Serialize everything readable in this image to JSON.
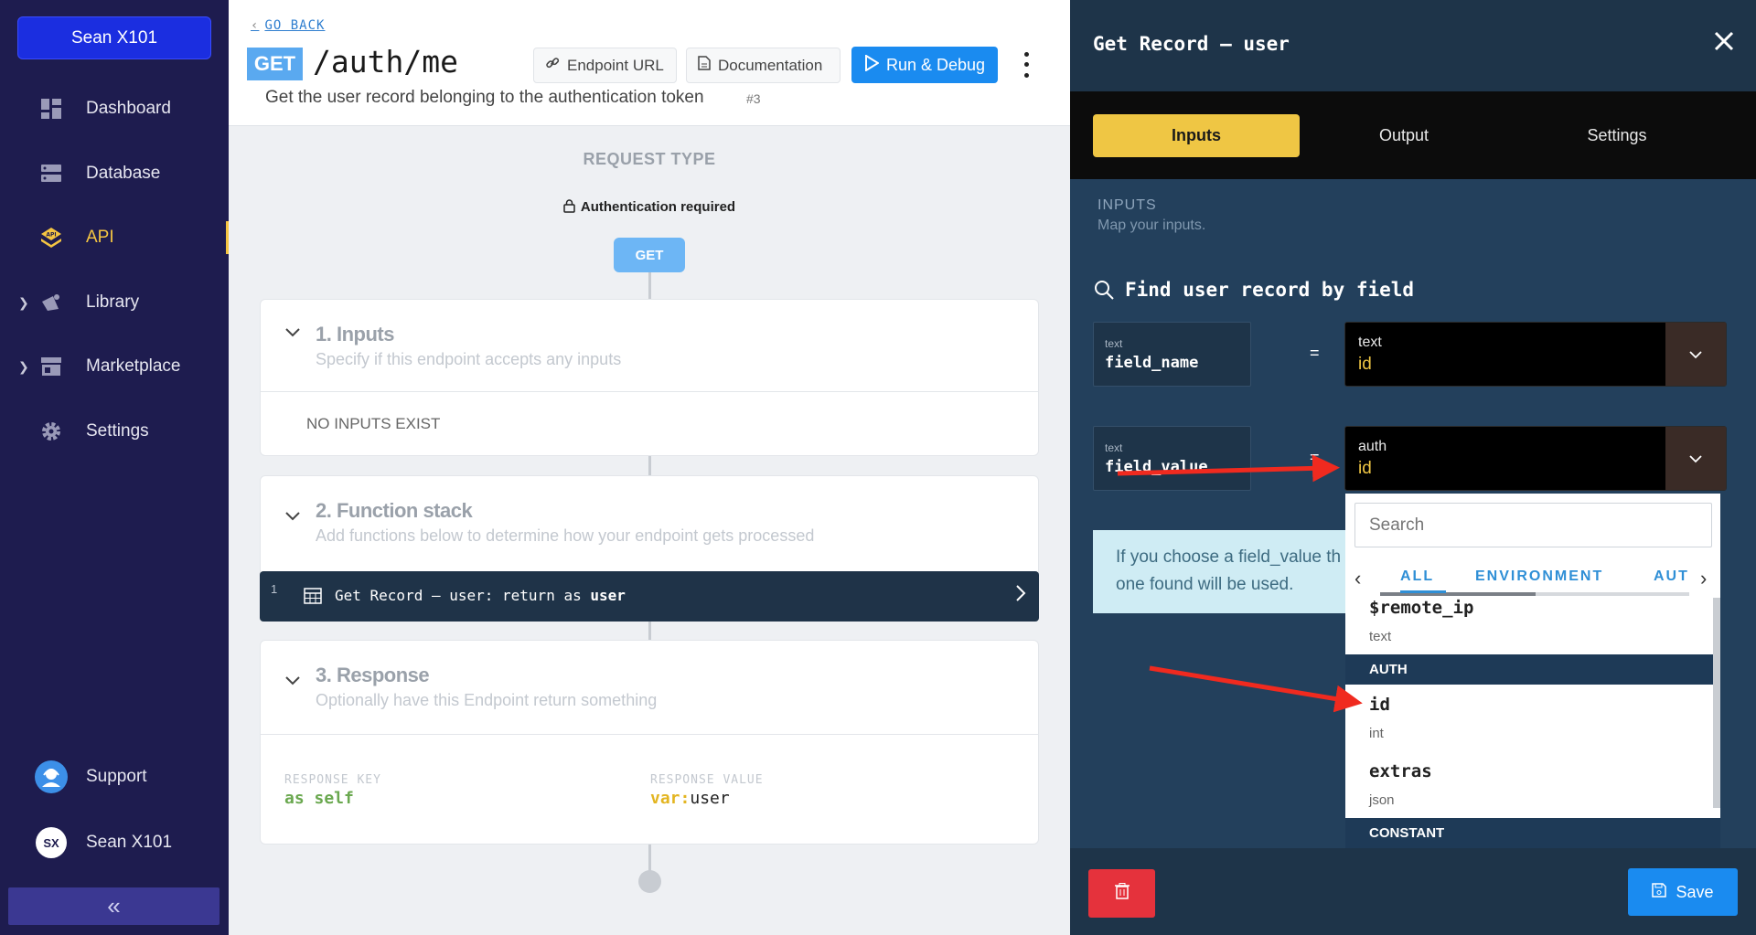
{
  "sidebar": {
    "workspace": "Sean X101",
    "items": [
      {
        "label": "Dashboard",
        "icon": "dashboard-icon"
      },
      {
        "label": "Database",
        "icon": "database-icon"
      },
      {
        "label": "API",
        "icon": "api-icon",
        "active": true
      },
      {
        "label": "Library",
        "icon": "library-icon",
        "expandable": true
      },
      {
        "label": "Marketplace",
        "icon": "marketplace-icon",
        "expandable": true
      },
      {
        "label": "Settings",
        "icon": "gear-icon"
      }
    ],
    "support_label": "Support",
    "user_initials": "SX",
    "user_name": "Sean X101",
    "collapse_glyph": "«"
  },
  "header": {
    "go_back": "GO BACK",
    "method": "GET",
    "path": "/auth/me",
    "description": "Get the user record belonging to the authentication token",
    "endpoint_id": "#3",
    "endpoint_url_label": "Endpoint URL",
    "documentation_label": "Documentation",
    "run_debug_label": "Run & Debug"
  },
  "canvas": {
    "request_type": "REQUEST TYPE",
    "auth_required": "Authentication required",
    "method_pill": "GET",
    "inputs": {
      "title": "1. Inputs",
      "subtitle": "Specify if this endpoint accepts any inputs",
      "empty": "NO INPUTS EXIST"
    },
    "function_stack": {
      "title": "2. Function stack",
      "subtitle": "Add functions below to determine how your endpoint gets processed",
      "rows": [
        {
          "index": "1",
          "text_prefix": "Get Record – user: return as ",
          "text_var": "user"
        }
      ]
    },
    "response": {
      "title": "3. Response",
      "subtitle": "Optionally have this Endpoint return something",
      "key_label": "RESPONSE KEY",
      "key_value": "as self",
      "value_label": "RESPONSE VALUE",
      "value_prefix": "var:",
      "value_name": "user"
    }
  },
  "panel": {
    "title": "Get Record – user",
    "tabs": [
      "Inputs",
      "Output",
      "Settings"
    ],
    "active_tab": "Inputs",
    "inputs_heading": "INPUTS",
    "inputs_sub": "Map your inputs.",
    "find_title": "Find user record by field",
    "fields": [
      {
        "type": "text",
        "name": "field_name",
        "equals": "=",
        "value_top": "text",
        "value_bottom": "id"
      },
      {
        "type": "text",
        "name": "field_value",
        "equals": "=",
        "value_top": "auth",
        "value_bottom": "id"
      }
    ],
    "info_text_1": "If you choose a field_value th",
    "info_text_2": "one found will be used.",
    "dropdown": {
      "search_placeholder": "Search",
      "tabs": [
        "ALL",
        "ENVIRONMENT",
        "AUT"
      ],
      "items_top": [
        {
          "name": "$remote_ip",
          "type": "text"
        }
      ],
      "group_auth": "AUTH",
      "items_auth": [
        {
          "name": "id",
          "type": "int"
        },
        {
          "name": "extras",
          "type": "json"
        }
      ],
      "group_constant": "CONSTANT"
    },
    "save_label": "Save"
  },
  "colors": {
    "sidebar_bg": "#1e1c4f",
    "accent_yellow": "#efc644",
    "primary_blue": "#1a8bf0",
    "panel_bg": "#23405c",
    "danger": "#e5323c",
    "annotation_red": "#f02a1f"
  }
}
